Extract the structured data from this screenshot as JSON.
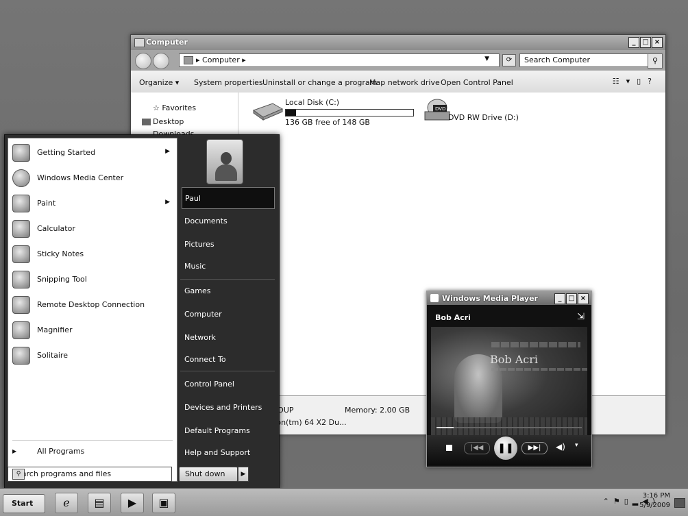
{
  "explorer": {
    "title": "Computer",
    "address": "Computer",
    "search_placeholder": "Search Computer",
    "commands": [
      "Organize ▾",
      "System properties",
      "Uninstall or change a program",
      "Map network drive",
      "Open Control Panel"
    ],
    "nav": [
      "Favorites",
      "Desktop",
      "Downloads"
    ],
    "drives": [
      {
        "name": "Local Disk (C:)",
        "free": "136 GB free of 148 GB",
        "used_fraction": 0.08
      },
      {
        "name": "DVD RW Drive (D:)"
      }
    ],
    "details": {
      "workgroup": "GROUP",
      "memory": "Memory: 2.00 GB",
      "processor": "thlon(tm) 64 X2 Du..."
    }
  },
  "start_menu": {
    "programs": [
      {
        "label": "Getting Started",
        "has_arrow": true
      },
      {
        "label": "Windows Media Center",
        "has_arrow": false
      },
      {
        "label": "Paint",
        "has_arrow": true
      },
      {
        "label": "Calculator",
        "has_arrow": false
      },
      {
        "label": "Sticky Notes",
        "has_arrow": false
      },
      {
        "label": "Snipping Tool",
        "has_arrow": false
      },
      {
        "label": "Remote Desktop Connection",
        "has_arrow": false
      },
      {
        "label": "Magnifier",
        "has_arrow": false
      },
      {
        "label": "Solitaire",
        "has_arrow": false
      }
    ],
    "all_programs": "All Programs",
    "search_placeholder": "Search programs and files",
    "user": "Paul",
    "right_items": [
      "Documents",
      "Pictures",
      "Music",
      "Games",
      "Computer",
      "Network",
      "Connect To",
      "Control Panel",
      "Devices and Printers",
      "Default Programs",
      "Help and Support"
    ],
    "shutdown": "Shut down"
  },
  "media_player": {
    "title": "Windows Media Player",
    "artist": "Bob Acri",
    "album_art_title": "Bob Acri",
    "progress": 0.12
  },
  "taskbar": {
    "start": "Start",
    "time": "3:16 PM",
    "date": "5/9/2009"
  }
}
